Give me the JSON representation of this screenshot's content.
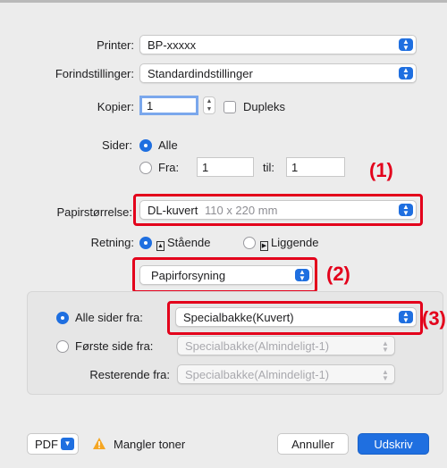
{
  "printer": {
    "label": "Printer:",
    "value": "BP-xxxxx"
  },
  "presets": {
    "label": "Forindstillinger:",
    "value": "Standardindstillinger"
  },
  "copies": {
    "label": "Kopier:",
    "value": "1",
    "duplex_label": "Dupleks"
  },
  "pages": {
    "label": "Sider:",
    "all_label": "Alle",
    "from_label": "Fra:",
    "from_value": "1",
    "to_label": "til:",
    "to_value": "1"
  },
  "paper_size": {
    "label": "Papirstørrelse:",
    "value": "DL-kuvert",
    "detail": "110 x 220 mm"
  },
  "orientation": {
    "label": "Retning:",
    "portrait": "Stående",
    "landscape": "Liggende"
  },
  "section_menu": {
    "value": "Papirforsyning"
  },
  "paper_feed": {
    "all_pages_label": "Alle sider fra:",
    "all_pages_value": "Specialbakke(Kuvert)",
    "first_page_label": "Første side fra:",
    "first_page_value": "Specialbakke(Almindeligt-1)",
    "remaining_label": "Resterende fra:",
    "remaining_value": "Specialbakke(Almindeligt-1)"
  },
  "footer": {
    "pdf_label": "PDF",
    "warning_text": "Mangler toner",
    "cancel_label": "Annuller",
    "print_label": "Udskriv"
  },
  "callouts": {
    "c1": "(1)",
    "c2": "(2)",
    "c3": "(3)"
  },
  "colors": {
    "accent": "#1f6fe0",
    "callout": "#e3001b",
    "warning": "#f5a623"
  },
  "icons": [
    "chevron-updown-icon",
    "warning-icon",
    "chevron-down-icon",
    "portrait-icon",
    "landscape-icon"
  ]
}
